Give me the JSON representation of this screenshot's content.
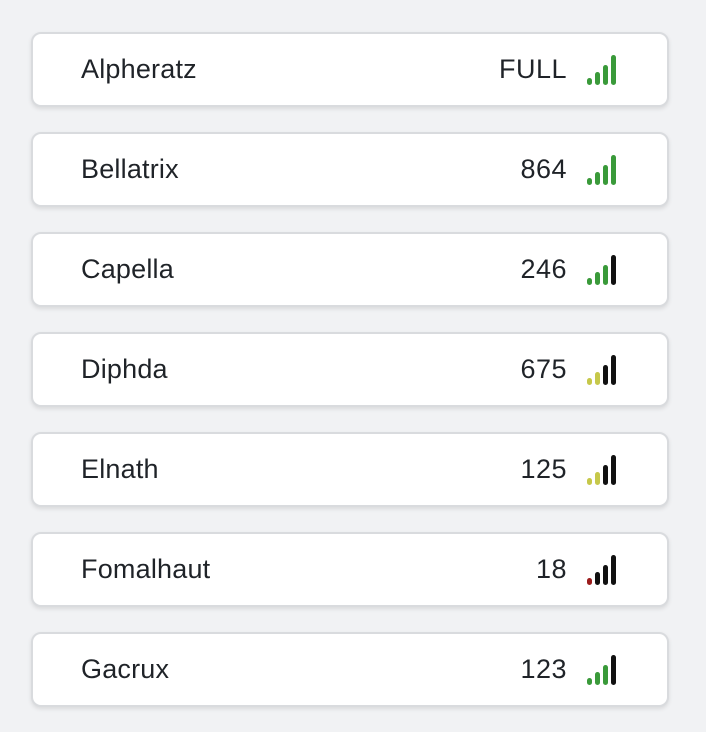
{
  "colors": {
    "green": "#3a9a3a",
    "yellow": "#c6c84a",
    "red": "#9b1c1c",
    "black": "#111111",
    "card_border": "#d9dbde",
    "background": "#f1f2f4"
  },
  "items": [
    {
      "name": "Alpheratz",
      "value": "FULL",
      "signal_icon": "signal-strength-icon",
      "signal_bars": [
        "green",
        "green",
        "green",
        "green"
      ]
    },
    {
      "name": "Bellatrix",
      "value": "864",
      "signal_icon": "signal-strength-icon",
      "signal_bars": [
        "green",
        "green",
        "green",
        "green"
      ]
    },
    {
      "name": "Capella",
      "value": "246",
      "signal_icon": "signal-strength-icon",
      "signal_bars": [
        "green",
        "green",
        "green",
        "black"
      ]
    },
    {
      "name": "Diphda",
      "value": "675",
      "signal_icon": "signal-strength-icon",
      "signal_bars": [
        "yellow",
        "yellow",
        "black",
        "black"
      ]
    },
    {
      "name": "Elnath",
      "value": "125",
      "signal_icon": "signal-strength-icon",
      "signal_bars": [
        "yellow",
        "yellow",
        "black",
        "black"
      ]
    },
    {
      "name": "Fomalhaut",
      "value": "18",
      "signal_icon": "signal-strength-icon",
      "signal_bars": [
        "red",
        "black",
        "black",
        "black"
      ]
    },
    {
      "name": "Gacrux",
      "value": "123",
      "signal_icon": "signal-strength-icon",
      "signal_bars": [
        "green",
        "green",
        "green",
        "black"
      ]
    }
  ]
}
